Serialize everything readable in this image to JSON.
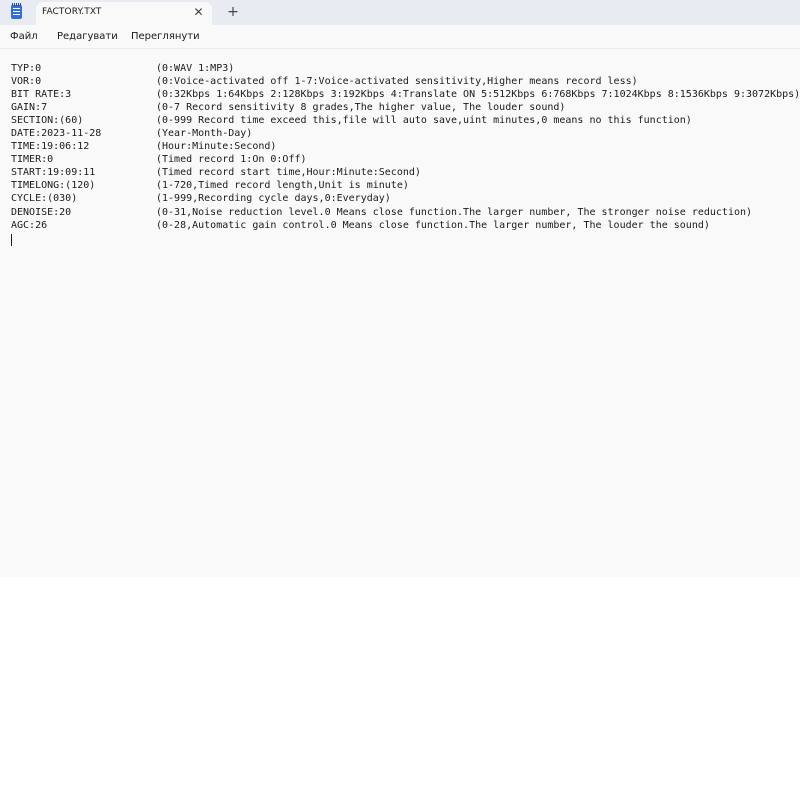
{
  "window": {
    "tab_title": "FACTORY.TXT",
    "tab_close_glyph": "✕",
    "new_tab_glyph": "+",
    "app_icon": "notepad-icon"
  },
  "menu": {
    "file": "Файл",
    "edit": "Редагувати",
    "view": "Переглянути"
  },
  "document": {
    "lines": [
      {
        "key": "TYP:0",
        "desc": "(0:WAV 1:MP3)"
      },
      {
        "key": "VOR:0",
        "desc": "(0:Voice-activated off 1-7:Voice-activated sensitivity,Higher means record less)"
      },
      {
        "key": "BIT RATE:3",
        "desc": "(0:32Kbps 1:64Kbps 2:128Kbps 3:192Kbps 4:Translate ON 5:512Kbps 6:768Kbps 7:1024Kbps 8:1536Kbps 9:3072Kbps)"
      },
      {
        "key": "GAIN:7",
        "desc": "(0-7 Record sensitivity 8 grades,The higher value, The louder sound)"
      },
      {
        "key": "SECTION:(60)",
        "desc": "(0-999 Record time exceed this,file will auto save,uint minutes,0 means no this function)"
      },
      {
        "key": "DATE:2023-11-28",
        "desc": "(Year-Month-Day)"
      },
      {
        "key": "TIME:19:06:12",
        "desc": "(Hour:Minute:Second)"
      },
      {
        "key": "TIMER:0",
        "desc": "(Timed record 1:On 0:Off)"
      },
      {
        "key": "START:19:09:11",
        "desc": "(Timed record start time,Hour:Minute:Second)"
      },
      {
        "key": "TIMELONG:(120)",
        "desc": "(1-720,Timed record length,Unit is minute)"
      },
      {
        "key": "CYCLE:(030)",
        "desc": "(1-999,Recording cycle days,0:Everyday)"
      },
      {
        "key": "DENOISE:20",
        "desc": "(0-31,Noise reduction level.0 Means close function.The larger number, The stronger noise reduction)"
      },
      {
        "key": "AGC:26",
        "desc": "(0-28,Automatic gain control.0 Means close function.The larger number, The louder the sound)"
      }
    ]
  },
  "colors": {
    "titlebar": "#e8ecf2",
    "editor_bg": "#f9f9f9",
    "text": "#1b1b1b",
    "accent": "#2f6fd6"
  }
}
